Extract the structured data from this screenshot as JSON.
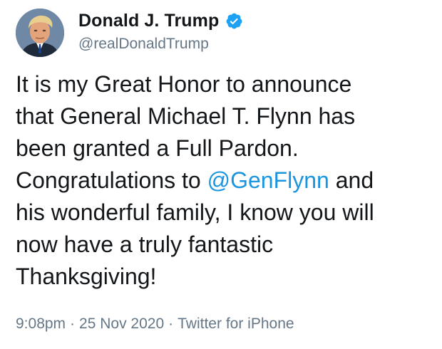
{
  "user": {
    "display_name": "Donald J. Trump",
    "handle": "@realDonaldTrump",
    "verified": true,
    "verified_icon": "verified-badge-icon",
    "avatar_icon": "profile-avatar"
  },
  "tweet": {
    "lines": [
      "It is my Great Honor to announce",
      "that General Michael T. Flynn has",
      "been granted a Full Pardon.",
      "Congratulations to ",
      "his wonderful family, I know you will",
      "now have a truly fantastic",
      "Thanksgiving!"
    ],
    "mention": "@GenFlynn",
    "line4_suffix": " and"
  },
  "meta": {
    "time": "9:08pm",
    "date": "25 Nov 2020",
    "source": "Twitter for iPhone",
    "separator": "·"
  },
  "colors": {
    "text": "#14171a",
    "secondary": "#657786",
    "link": "#1b95e0",
    "verified": "#1da1f2"
  }
}
